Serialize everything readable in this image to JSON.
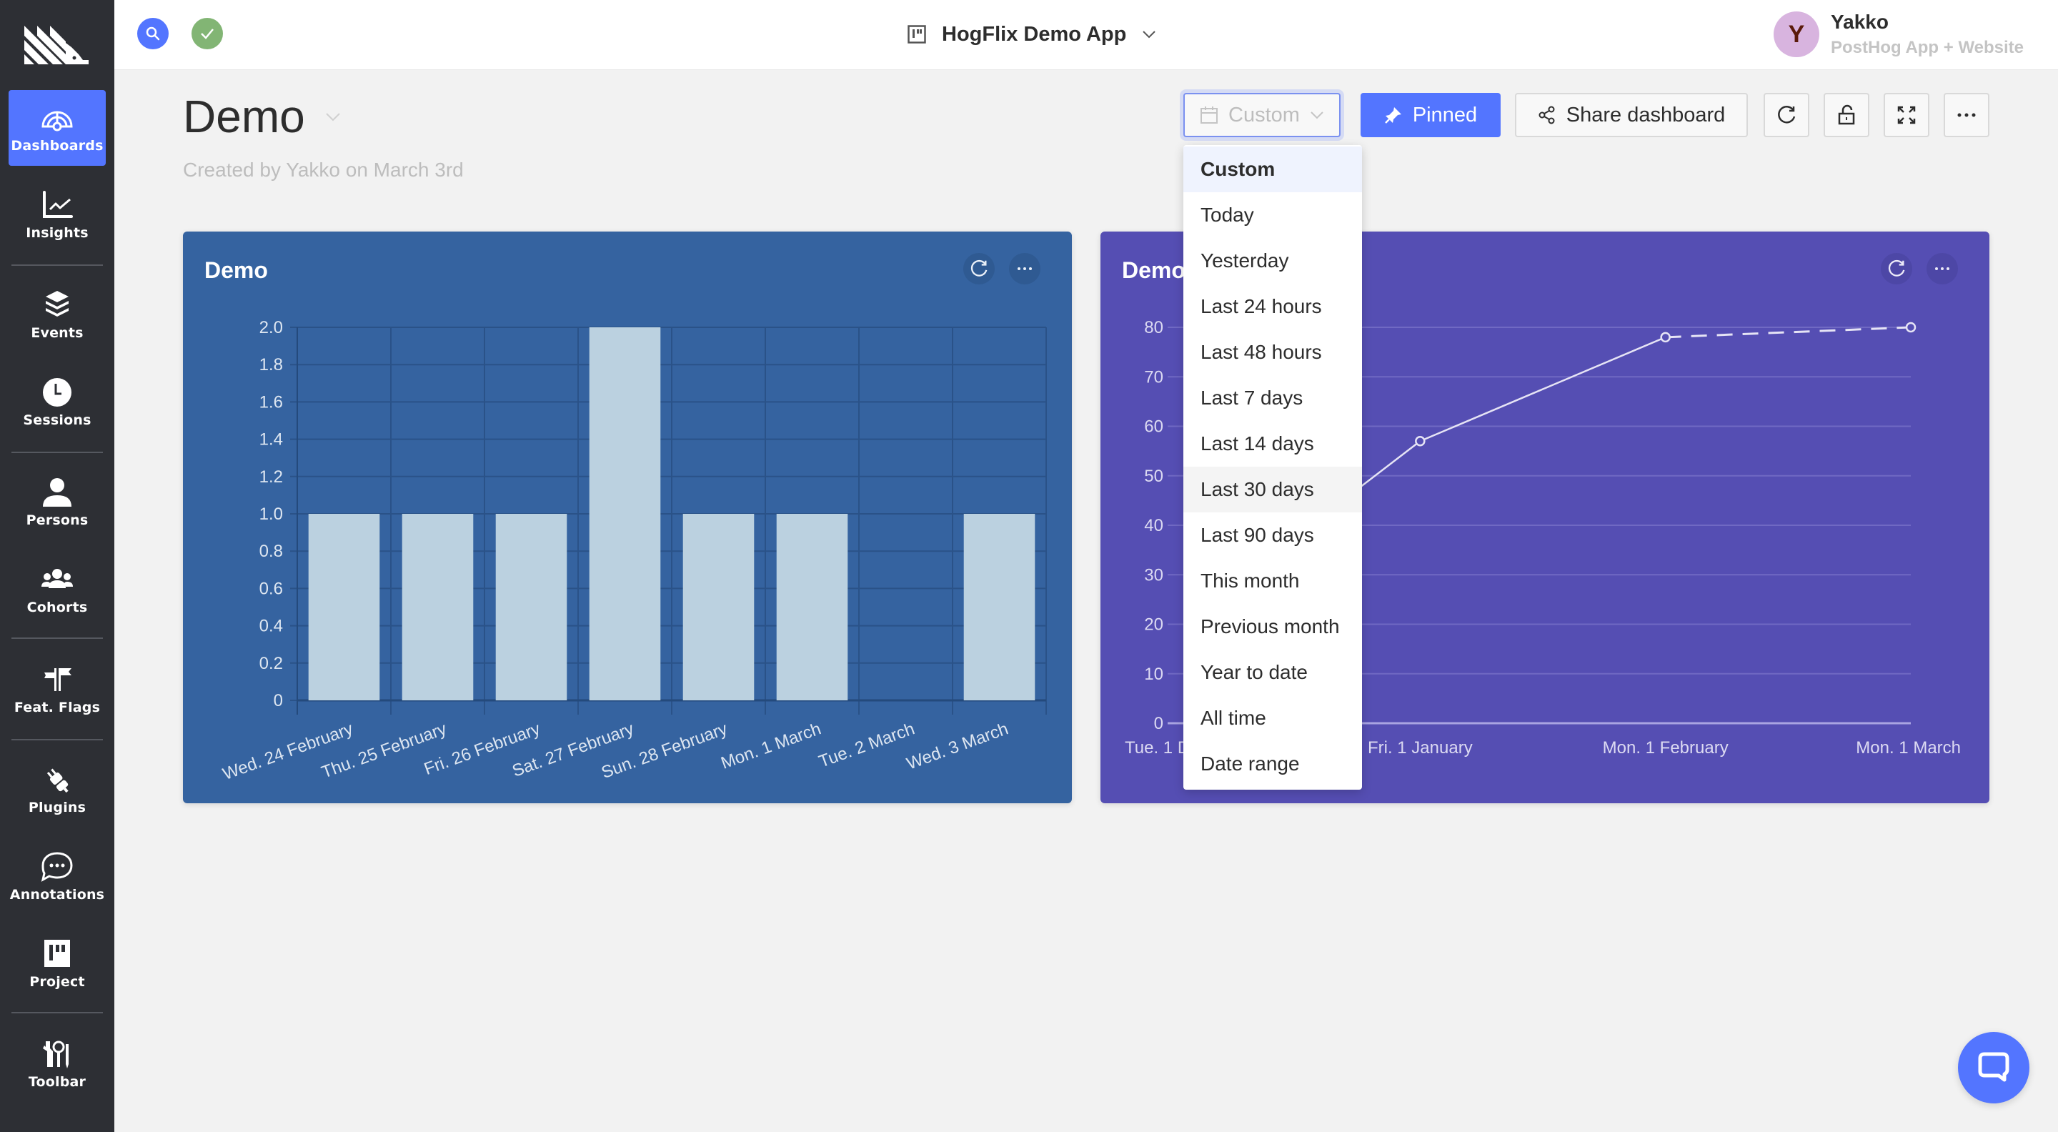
{
  "sidebar": {
    "items": [
      {
        "label": "Dashboards",
        "icon": "dashboard-gauge-icon",
        "active": true
      },
      {
        "label": "Insights",
        "icon": "line-chart-icon"
      },
      {
        "label": "Events",
        "icon": "layers-icon"
      },
      {
        "label": "Sessions",
        "icon": "clock-icon"
      },
      {
        "label": "Persons",
        "icon": "person-icon"
      },
      {
        "label": "Cohorts",
        "icon": "users-group-icon"
      },
      {
        "label": "Feat. Flags",
        "icon": "flags-icon"
      },
      {
        "label": "Plugins",
        "icon": "plug-icon"
      },
      {
        "label": "Annotations",
        "icon": "chat-bubble-icon"
      },
      {
        "label": "Project",
        "icon": "project-board-icon"
      },
      {
        "label": "Toolbar",
        "icon": "tools-icon"
      }
    ]
  },
  "topbar": {
    "project_name": "HogFlix Demo App",
    "user": {
      "initial": "Y",
      "name": "Yakko",
      "org": "PostHog App + Website"
    }
  },
  "dashboard": {
    "title": "Demo",
    "subtitle": "Created by Yakko on March 3rd",
    "date_filter": {
      "value": "Custom"
    },
    "pinned_label": "Pinned",
    "share_label": "Share dashboard"
  },
  "date_dropdown": {
    "options": [
      "Custom",
      "Today",
      "Yesterday",
      "Last 24 hours",
      "Last 48 hours",
      "Last 7 days",
      "Last 14 days",
      "Last 30 days",
      "Last 90 days",
      "This month",
      "Previous month",
      "Year to date",
      "All time",
      "Date range"
    ],
    "selected": "Custom",
    "hovered": "Last 30 days"
  },
  "colors": {
    "accent": "#5375ff",
    "card_blue": "#3563a0",
    "card_purple": "#554eb3",
    "bar_fill": "#bbd1e0",
    "sidebar_bg": "#2d2f34",
    "success": "#82b574"
  },
  "chart_data": [
    {
      "type": "bar",
      "title": "Demo",
      "categories": [
        "Wed. 24 February",
        "Thu. 25 February",
        "Fri. 26 February",
        "Sat. 27 February",
        "Sun. 28 February",
        "Mon. 1 March",
        "Tue. 2 March",
        "Wed. 3 March"
      ],
      "values": [
        1,
        1,
        1,
        2,
        1,
        1,
        0,
        1
      ],
      "yticks": [
        "0",
        "0.2",
        "0.4",
        "0.6",
        "0.8",
        "1.0",
        "1.2",
        "1.4",
        "1.6",
        "1.8",
        "2.0"
      ],
      "ylim": [
        0,
        2
      ],
      "xlabel": "",
      "ylabel": "",
      "grid": true,
      "legend": "none"
    },
    {
      "type": "line",
      "title": "Demo",
      "categories": [
        "Tue. 1 December",
        "Fri. 1 January",
        "Mon. 1 February",
        "Mon. 1 March"
      ],
      "x_visible_labels": [
        "Tue. 1 D",
        "Fri. 1 January",
        "Mon. 1 February",
        "Mon. 1 March"
      ],
      "values": [
        null,
        57,
        78,
        80
      ],
      "partial_segment": "last (dashed)",
      "yticks": [
        "0",
        "10",
        "20",
        "30",
        "40",
        "50",
        "60",
        "70",
        "80"
      ],
      "ylim": [
        0,
        80
      ],
      "xlabel": "",
      "ylabel": "",
      "grid": true,
      "legend": "none",
      "note": "first point hidden behind date dropdown"
    }
  ]
}
